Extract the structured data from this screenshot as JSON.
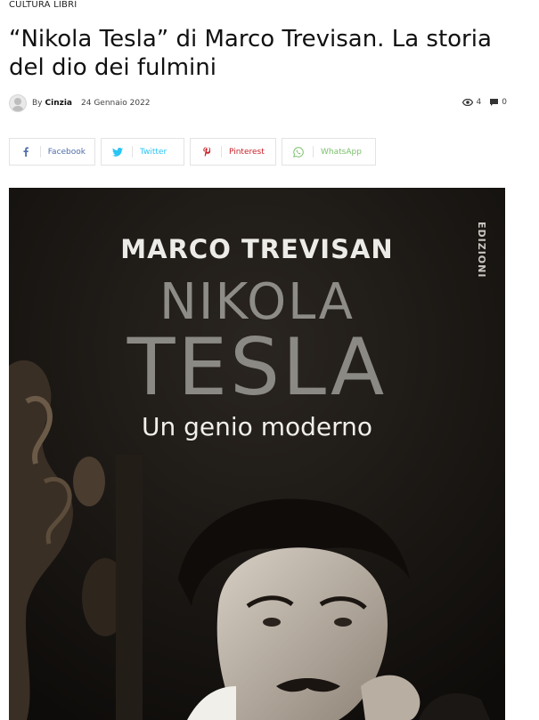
{
  "article": {
    "category": "CULTURA LIBRI",
    "title": "“Nikola Tesla” di Marco Trevisan. La storia del dio dei fulmini",
    "by_label": "By",
    "author": "Cinzia",
    "date": "24 Gennaio 2022",
    "views": "4",
    "comments": "0"
  },
  "share": {
    "buttons": [
      {
        "label": "Facebook",
        "icon": "facebook-icon",
        "color": "#516eab"
      },
      {
        "label": "Twitter",
        "icon": "twitter-icon",
        "color": "#29c5f6"
      },
      {
        "label": "Pinterest",
        "icon": "pinterest-icon",
        "color": "#ca212a"
      },
      {
        "label": "WhatsApp",
        "icon": "whatsapp-icon",
        "color": "#7bbf6a"
      }
    ]
  },
  "cover": {
    "author": "MARCO TREVISAN",
    "first_name": "NIKOLA",
    "last_name": "TESLA",
    "subtitle": "Un genio moderno",
    "publisher": "EDIZIONI"
  }
}
